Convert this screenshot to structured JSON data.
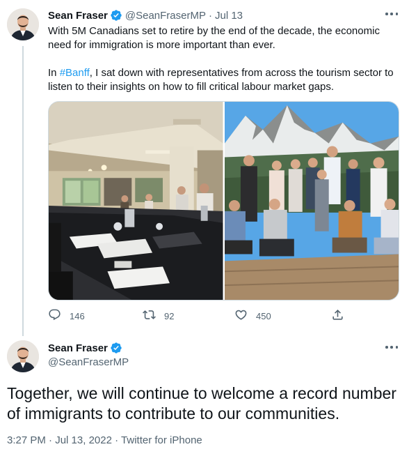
{
  "first_tweet": {
    "author_name": "Sean Fraser",
    "handle": "@SeanFraserMP",
    "separator": "·",
    "date": "Jul 13",
    "text_p1": "With 5M Canadians set to retire by the end of the decade, the economic need for immigration is more important than ever.",
    "text_p2_before": "In ",
    "hashtag": "#Banff",
    "text_p2_after": ", I sat down with representatives from across the tourism sector to listen to their insights on how to fill critical labour market gaps.",
    "replies": "146",
    "retweets": "92",
    "likes": "450"
  },
  "second_tweet": {
    "author_name": "Sean Fraser",
    "handle": "@SeanFraserMP",
    "text": "Together, we will continue to welcome a record number of immigrants to contribute to our communities.",
    "time": "3:27 PM",
    "date": "Jul 13, 2022",
    "source": "Twitter for iPhone",
    "separator": "·"
  },
  "icons": {
    "verified": "verified-badge-icon",
    "more": "more-options-icon",
    "reply": "reply-icon",
    "retweet": "retweet-icon",
    "like": "like-icon",
    "share": "share-icon"
  },
  "colors": {
    "text": "#0f1419",
    "secondary": "#536471",
    "accent": "#1d9bf0",
    "border": "#cfd9de"
  }
}
